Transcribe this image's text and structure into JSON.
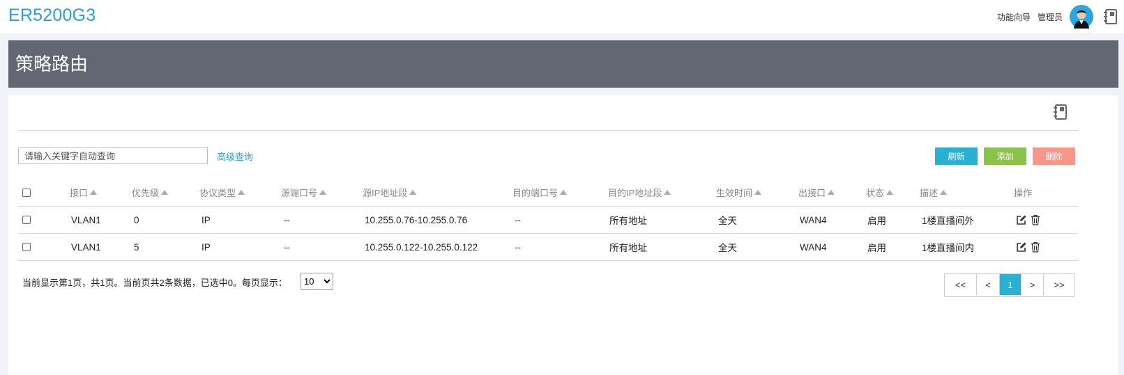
{
  "app": {
    "brand": "ER5200G3"
  },
  "topbar": {
    "wizard_link": "功能向导",
    "admin_link": "管理员"
  },
  "page": {
    "title": "策略路由"
  },
  "toolbar": {
    "search_placeholder": "请输入关键字自动查询",
    "advanced_search": "高级查询",
    "refresh": "刷新",
    "add": "添加",
    "delete": "删除"
  },
  "table": {
    "headers": {
      "interface": "接口",
      "priority": "优先级",
      "protocol": "协议类型",
      "src_port": "源端口号",
      "src_ip": "源IP地址段",
      "dst_port": "目的端口号",
      "dst_ip": "目的IP地址段",
      "time": "生效时间",
      "out_if": "出接口",
      "state": "状态",
      "desc": "描述",
      "op": "操作"
    },
    "rows": [
      {
        "interface": "VLAN1",
        "priority": "0",
        "protocol": "IP",
        "src_port": "--",
        "src_ip": "10.255.0.76-10.255.0.76",
        "dst_port": "--",
        "dst_ip": "所有地址",
        "time": "全天",
        "out_if": "WAN4",
        "state": "启用",
        "desc": "1楼直播间外"
      },
      {
        "interface": "VLAN1",
        "priority": "5",
        "protocol": "IP",
        "src_port": "--",
        "src_ip": "10.255.0.122-10.255.0.122",
        "dst_port": "--",
        "dst_ip": "所有地址",
        "time": "全天",
        "out_if": "WAN4",
        "state": "启用",
        "desc": "1楼直播间内"
      }
    ]
  },
  "footer": {
    "page_info": "当前显示第1页，共1页。当前页共2条数据，已选中0。每页显示：",
    "page_size": "10",
    "pager": {
      "first": "<<",
      "prev": "<",
      "current": "1",
      "next": ">",
      "last": ">>"
    }
  },
  "icons": [
    "avatar-icon",
    "notebook-icon",
    "edit-icon",
    "trash-icon",
    "sort-asc-icon",
    "chevron-down-icon"
  ],
  "colors": {
    "brand": "#2a9fd6",
    "title_band": "#636673",
    "refresh": "#2ab0d2",
    "add": "#8bc34a",
    "delete": "#f7978a"
  }
}
